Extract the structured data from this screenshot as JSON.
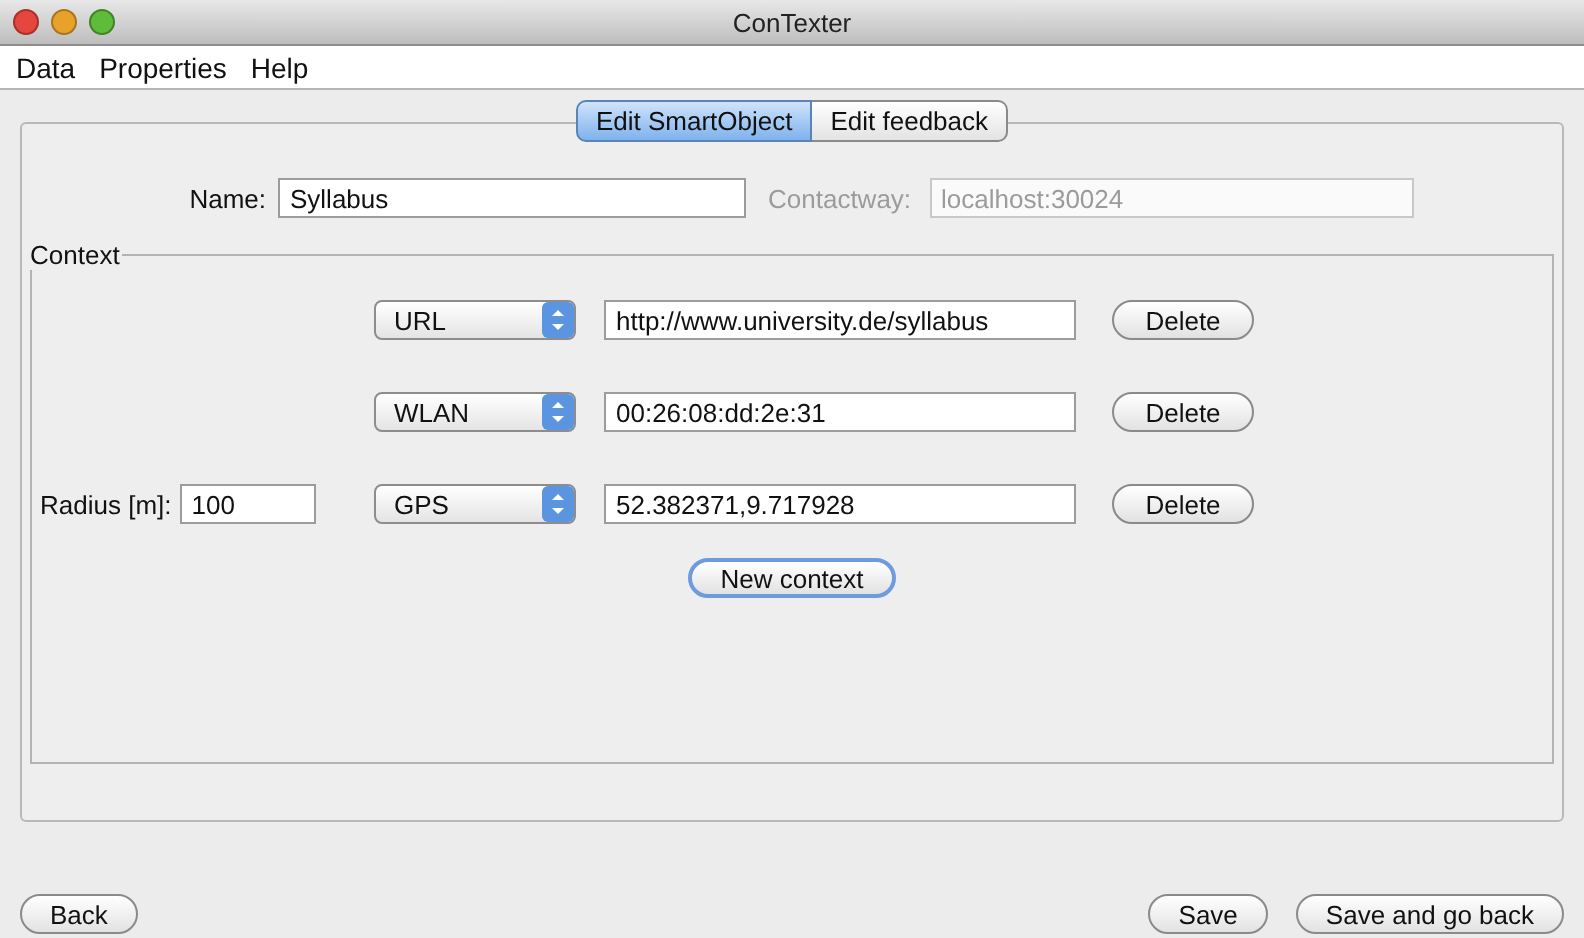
{
  "window": {
    "title": "ConTexter"
  },
  "menu": [
    "Data",
    "Properties",
    "Help"
  ],
  "tabs": [
    {
      "label": "Edit SmartObject",
      "selected": true
    },
    {
      "label": "Edit feedback",
      "selected": false
    }
  ],
  "name_field": {
    "label": "Name:",
    "value": "Syllabus"
  },
  "contactway_field": {
    "label": "Contactway:",
    "value": "localhost:30024",
    "disabled": true
  },
  "context": {
    "title": "Context",
    "rows": [
      {
        "type": "URL",
        "value": "http://www.university.de/syllabus",
        "delete": "Delete"
      },
      {
        "type": "WLAN",
        "value": "00:26:08:dd:2e:31",
        "delete": "Delete"
      },
      {
        "type": "GPS",
        "value": "52.382371,9.717928",
        "delete": "Delete",
        "radius_label": "Radius [m]:",
        "radius": "100"
      }
    ],
    "new_button": {
      "label": "New context",
      "focused": true
    }
  },
  "buttons": [
    {
      "label": "Back",
      "focused": false
    },
    {
      "label": "Save",
      "focused": false
    },
    {
      "label": "Save and go back",
      "focused": false
    }
  ]
}
